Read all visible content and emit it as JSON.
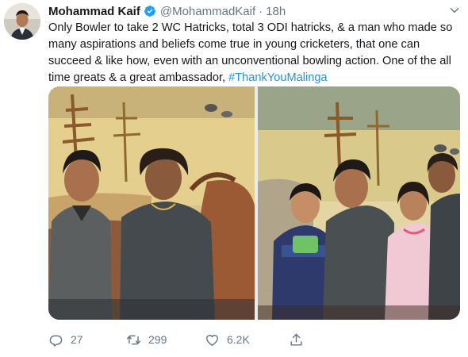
{
  "tweet": {
    "author_name": "Mohammad Kaif",
    "handle": "@MohammadKaif",
    "separator": "·",
    "time": "18h",
    "text": "Only Bowler to take 2 WC Hatricks, total 3 ODI hatricks, & a man who made so many aspirations and beliefs come true in young cricketers, that one can succeed & like how, even with an unconventional bowling action. One of the all time greats & a great ambassador, ",
    "hashtag": "#ThankYouMalinga"
  },
  "actions": {
    "replies": "27",
    "retweets": "299",
    "likes": "6.2K"
  },
  "colors": {
    "link": "#1b95e0",
    "verified": "#1da1f2",
    "muted": "#657786"
  },
  "icons": [
    "verified-badge-icon",
    "chevron-down-icon",
    "reply-icon",
    "retweet-icon",
    "like-icon",
    "share-icon"
  ]
}
